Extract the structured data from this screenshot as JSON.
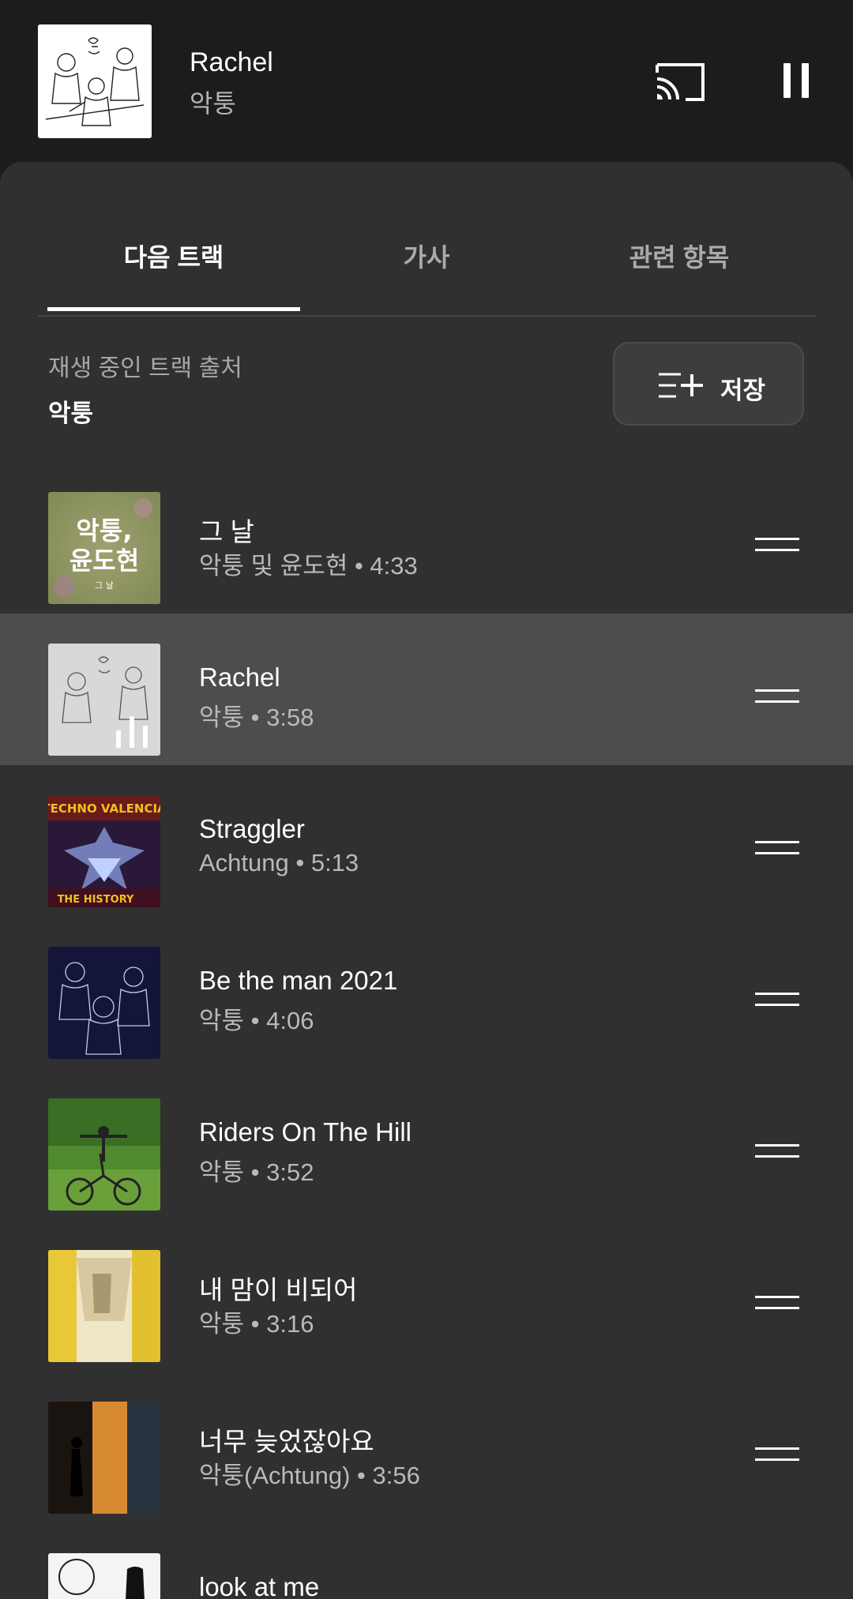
{
  "now_playing": {
    "title": "Rachel",
    "artist": "악퉁"
  },
  "tabs": [
    {
      "label": "다음 트랙",
      "active": true
    },
    {
      "label": "가사",
      "active": false
    },
    {
      "label": "관련 항목",
      "active": false
    }
  ],
  "source": {
    "label": "재생 중인 트랙 출처",
    "name": "악퉁"
  },
  "save_button": {
    "label": "저장"
  },
  "queue": [
    {
      "title": "그 날",
      "subtitle": "악퉁 및 윤도현 • 4:33",
      "art_text": "악퉁,\n윤도현",
      "art_small": "그 날"
    },
    {
      "title": "Rachel",
      "subtitle": "악퉁 • 3:58",
      "playing": true
    },
    {
      "title": "Straggler",
      "subtitle": "Achtung • 5:13",
      "art_text": "TECHNO VALENCIA",
      "art_small": "THE HISTORY"
    },
    {
      "title": "Be the man 2021",
      "subtitle": "악퉁 • 4:06"
    },
    {
      "title": "Riders On The Hill",
      "subtitle": "악퉁 • 3:52"
    },
    {
      "title": "내 맘이 비되어",
      "subtitle": "악퉁 • 3:16"
    },
    {
      "title": "너무 늦었잖아요",
      "subtitle": "악퉁(Achtung) • 3:56"
    },
    {
      "title": "look at me",
      "subtitle": ""
    }
  ],
  "colors": {
    "background": "#1c1c1c",
    "sheet": "#303030",
    "playing_row": "#4d4d4d",
    "secondary_text": "#b9b9b9"
  }
}
